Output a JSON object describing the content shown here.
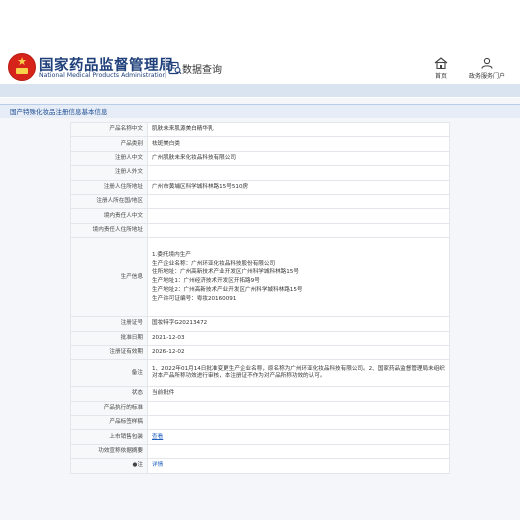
{
  "header": {
    "org_name_cn": "国家药品监督管理局",
    "org_name_en": "National Medical Products Administration",
    "section_label": "数据查询",
    "nav": [
      {
        "label": "首页",
        "icon": "home-icon"
      },
      {
        "label": "政务服务门户",
        "icon": "portal-icon"
      }
    ],
    "colors": {
      "brand_blue": "#1e3f7a",
      "emblem_red": "#d7241b",
      "bar_blue": "#d9e4f0"
    }
  },
  "panel": {
    "title": "国产特殊化妆品注册信息基本信息",
    "rows": [
      {
        "label": "产品名称中文",
        "value": "肌肤未来肌源美白精华乳"
      },
      {
        "label": "产品类别",
        "value": "祛斑美白类"
      },
      {
        "label": "注册人中文",
        "value": "广州肌肤未来化妆品科技有限公司"
      },
      {
        "label": "注册人外文",
        "value": ""
      },
      {
        "label": "注册人住所地址",
        "value": "广州市黄埔区科学城科林路15号510房"
      },
      {
        "label": "注册人所在国/地区",
        "value": ""
      },
      {
        "label": "境内责任人中文",
        "value": ""
      },
      {
        "label": "境内责任人住所地址",
        "value": ""
      }
    ],
    "production": {
      "label": "生产信息",
      "lines": [
        "1.委托境内生产",
        "生产企业名称：广州环亚化妆品科技股份有限公司",
        "住所地址：广州高新技术产业开发区广州科学城科林路15号",
        "生产地址1：广州经济技术开发区开拓路9号",
        "生产地址2：广州高新技术产业开发区广州科学城科林路15号",
        "生产许可证编号：粤妆20160091"
      ]
    },
    "rows2": [
      {
        "label": "注册证号",
        "value": "国妆特字G20213472"
      },
      {
        "label": "批准日期",
        "value": "2021-12-03"
      },
      {
        "label": "注册证有效期",
        "value": "2026-12-02"
      }
    ],
    "remark": {
      "label": "备注",
      "value": "1、2022年01月14日批准变更生产企业名称，原名称为广州环亚化妆品科技有限公司。2、国家药品监督管理局未组织对本产品所称功效进行审核，本注册证不作为对产品所称功效的认可。"
    },
    "rows3": [
      {
        "label": "状态",
        "value": "当前批件"
      },
      {
        "label": "产品执行的标准",
        "value": ""
      },
      {
        "label": "产品标签样稿",
        "value": ""
      }
    ],
    "instructions": {
      "label": "上市销售包装",
      "link": "查看"
    },
    "efficacy": {
      "label": "功效宣称依据摘要",
      "value": ""
    },
    "note": {
      "label": "●注",
      "link": "详情"
    }
  }
}
